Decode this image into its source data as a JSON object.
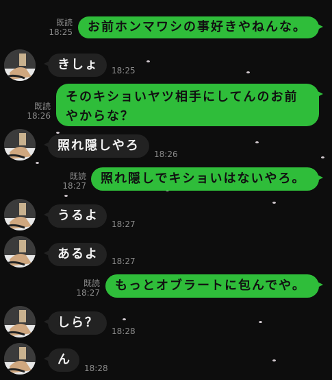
{
  "messages": [
    {
      "side": "out",
      "text": "お前ホンマワシの事好きやねんな。",
      "read": "既読",
      "time": "18:25"
    },
    {
      "side": "in",
      "text": "きしょ",
      "time": "18:25"
    },
    {
      "side": "out",
      "text_line1": "そのキショいヤツ相手にしてんのお前",
      "text_line2": "やからな？",
      "read": "既読",
      "time": "18:26"
    },
    {
      "side": "in",
      "text": "照れ隠しやろ",
      "time": "18:26"
    },
    {
      "side": "out",
      "text": "照れ隠しでキショいはないやろ。",
      "read": "既読",
      "time": "18:27"
    },
    {
      "side": "in",
      "text": "うるよ",
      "time": "18:27"
    },
    {
      "side": "in",
      "text": "あるよ",
      "time": "18:27"
    },
    {
      "side": "out",
      "text": "もっとオブラートに包んでや。",
      "read": "既読",
      "time": "18:27"
    },
    {
      "side": "in",
      "text": "しら？",
      "time": "18:28"
    },
    {
      "side": "in",
      "text": "ん",
      "time": "18:28"
    }
  ],
  "colors": {
    "background": "#0d0d0d",
    "outgoing_bubble": "#2fbd3a",
    "incoming_bubble": "#222222",
    "meta_text": "#8a8a8a"
  },
  "icons": {
    "avatar": "contact-avatar-icon"
  }
}
